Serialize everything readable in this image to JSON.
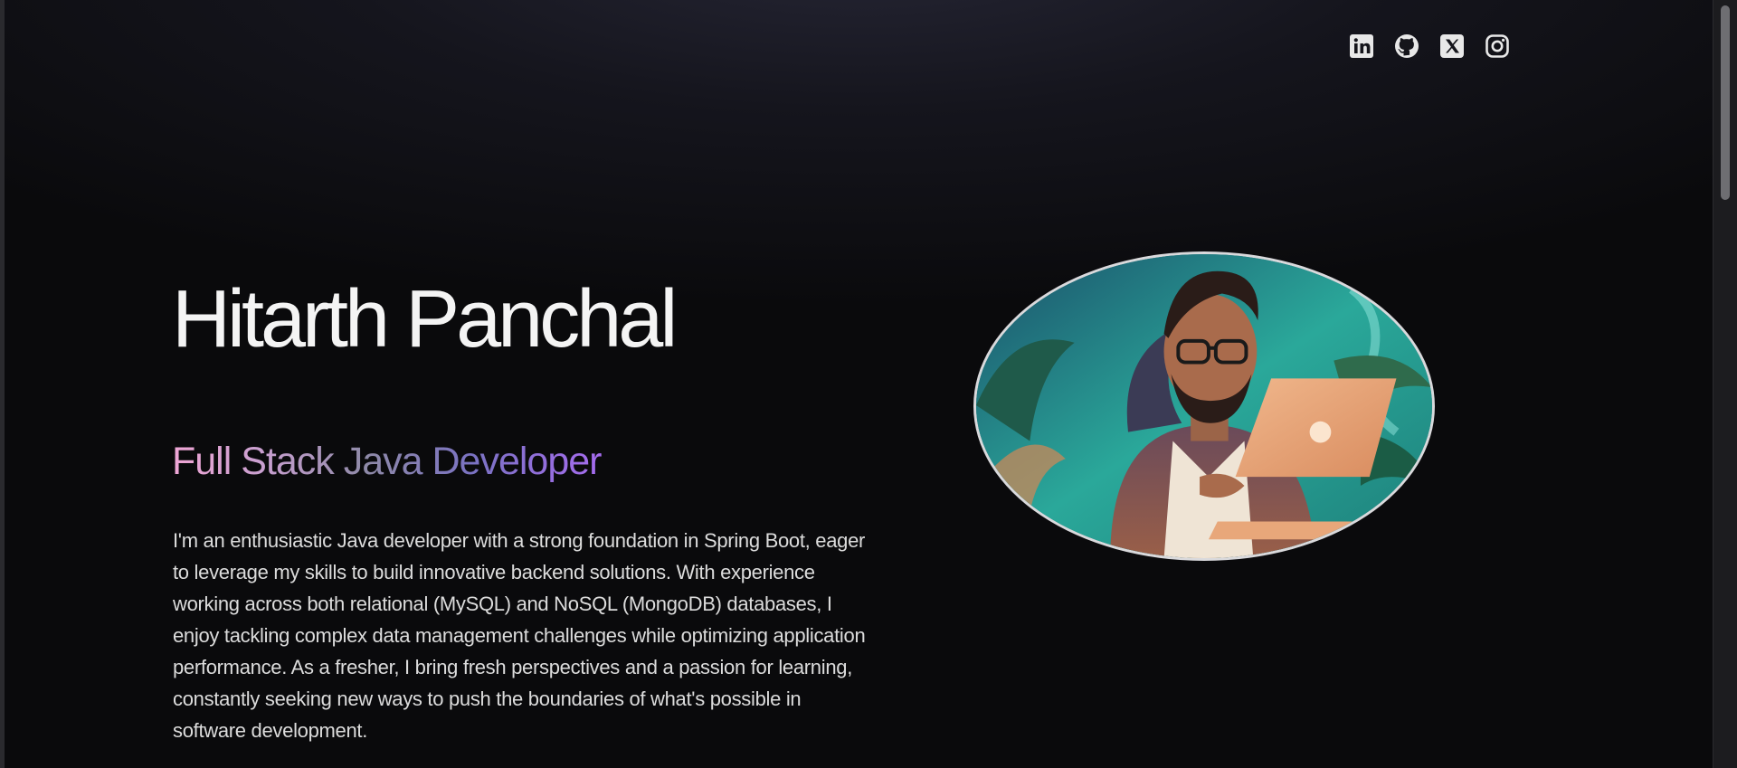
{
  "social": {
    "links": [
      {
        "name": "linkedin",
        "icon": "linkedin-icon"
      },
      {
        "name": "github",
        "icon": "github-icon"
      },
      {
        "name": "x",
        "icon": "x-twitter-icon"
      },
      {
        "name": "instagram",
        "icon": "instagram-icon"
      }
    ],
    "icon_color": "#e8e8e8"
  },
  "hero": {
    "name": "Hitarth Panchal",
    "role": "Full Stack Java Developer",
    "bio": "I'm an enthusiastic Java developer with a strong foundation in Spring Boot, eager to leverage my skills to build innovative backend solutions. With experience working across both relational (MySQL) and NoSQL (MongoDB) databases, I enjoy tackling complex data management challenges while optimizing application performance. As a fresher, I bring fresh perspectives and a passion for learning, constantly seeking new ways to push the boundaries of what's possible in software development."
  },
  "avatar": {
    "subject": "illustrated-developer-with-laptop",
    "border_color": "#d9d9dc"
  },
  "theme": {
    "background": "#0a0a0c",
    "role_gradient": [
      "#f0a6d6",
      "#8f8aa8",
      "#a66cf0"
    ]
  }
}
